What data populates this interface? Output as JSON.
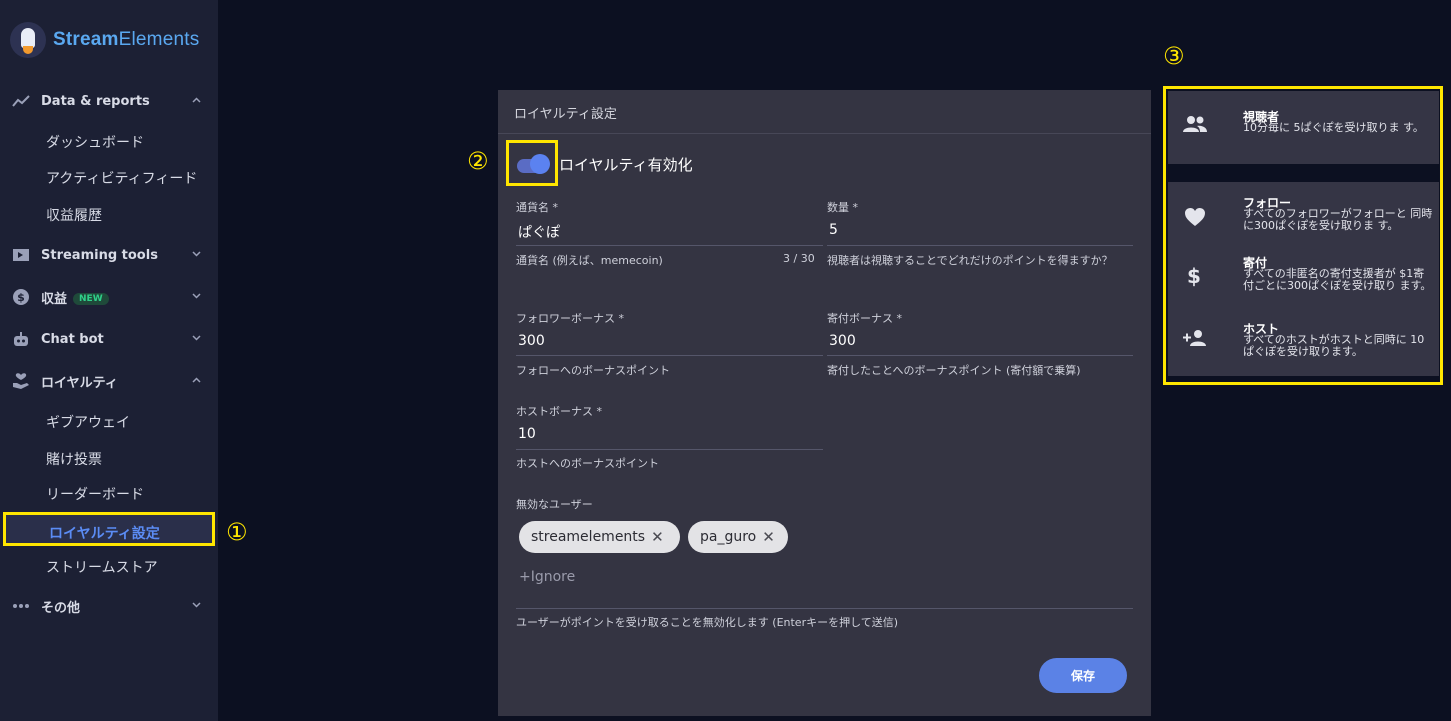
{
  "brand": {
    "bold": "Stream",
    "light": "Elements"
  },
  "sidebar": {
    "sections": [
      {
        "label": "Data & reports"
      },
      {
        "label": "Streaming tools"
      },
      {
        "label": "収益",
        "badge": "NEW"
      },
      {
        "label": "Chat bot"
      },
      {
        "label": "ロイヤルティ"
      },
      {
        "label": "その他"
      }
    ],
    "data_reports_items": [
      "ダッシュボード",
      "アクティビティフィード",
      "収益履歴"
    ],
    "loyalty_items": [
      "ギブアウェイ",
      "賭け投票",
      "リーダーボード",
      "ロイヤルティ設定",
      "ストリームストア"
    ]
  },
  "annotations": {
    "one": "①",
    "two": "②",
    "three": "③"
  },
  "card": {
    "title": "ロイヤルティ設定",
    "toggle_label": "ロイヤルティ有効化",
    "currency": {
      "label": "通貨名 *",
      "value": "ぱぐぽ",
      "hint": "通貨名 (例えば、memecoin)",
      "counter": "3 / 30"
    },
    "amount": {
      "label": "数量 *",
      "value": "5",
      "hint": "視聴者は視聴することでどれだけのポイントを得ますか？"
    },
    "follower_bonus": {
      "label": "フォロワーボーナス *",
      "value": "300",
      "hint": "フォローへのボーナスポイント"
    },
    "tip_bonus": {
      "label": "寄付ボーナス *",
      "value": "300",
      "hint": "寄付したことへのボーナスポイント (寄付額で乗算)"
    },
    "host_bonus": {
      "label": "ホストボーナス *",
      "value": "10",
      "hint": "ホストへのボーナスポイント"
    },
    "disabled_users": {
      "label": "無効なユーザー",
      "chips": [
        "streamelements",
        "pa_guro"
      ],
      "ignore": "+Ignore",
      "hint": "ユーザーがポイントを受け取ることを無効化します (Enterキーを押して送信)"
    },
    "save": "保存"
  },
  "right": {
    "viewers": {
      "title": "視聴者",
      "desc": "10分毎に 5ぱぐぽを受け取りま す。"
    },
    "follow": {
      "title": "フォロー",
      "desc": "すべてのフォロワーがフォローと 同時に300ぱぐぽを受け取りま す。"
    },
    "tip": {
      "title": "寄付",
      "desc": "すべての非匿名の寄付支援者が $1寄付ごとに300ぱぐぽを受け取り ます。"
    },
    "host": {
      "title": "ホスト",
      "desc": "すべてのホストがホストと同時に 10ぱぐぽを受け取ります。"
    }
  },
  "colors": {
    "accent": "#5b82e6",
    "highlight": "#ffe600",
    "sidebar": "#1c2034",
    "card": "#343442"
  }
}
